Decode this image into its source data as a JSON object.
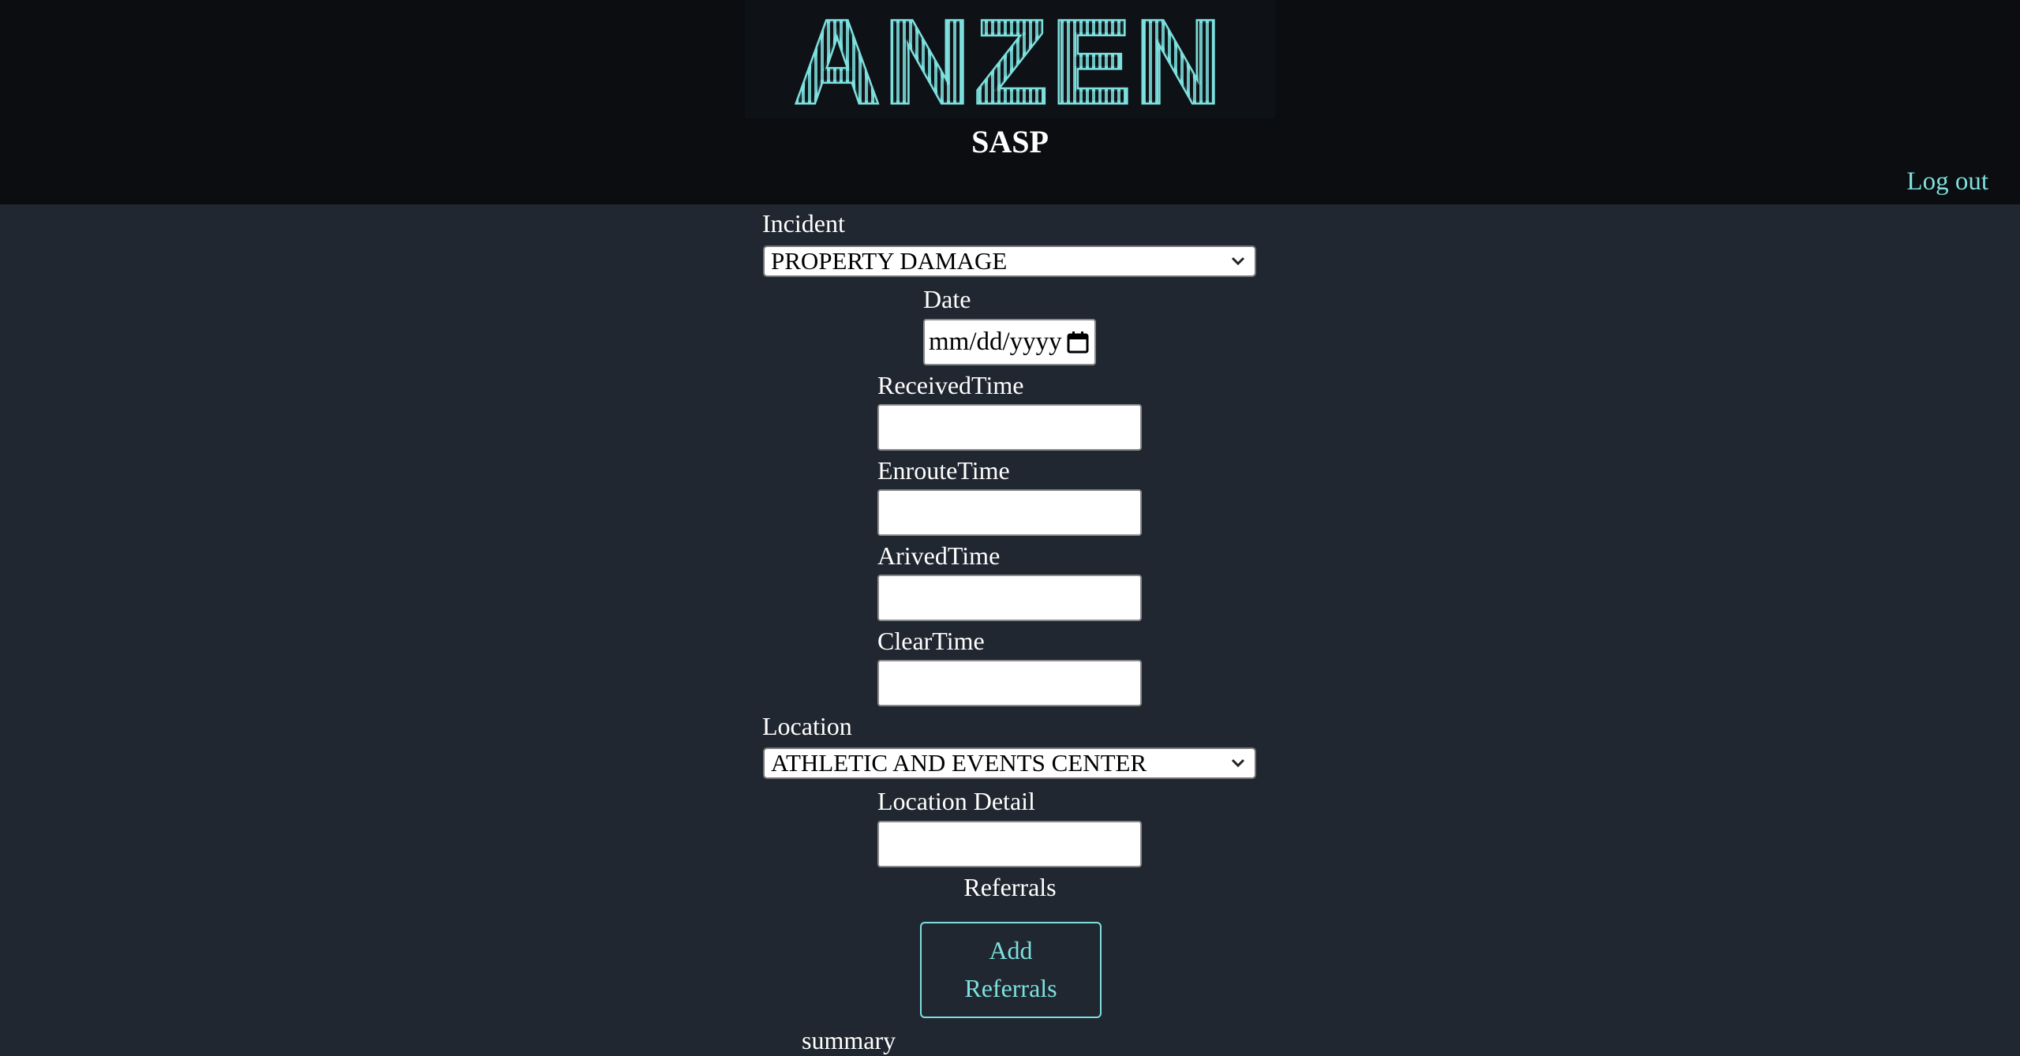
{
  "header": {
    "logo_text": "ANZEN",
    "title": "SASP",
    "logout_label": "Log out",
    "accent_color": "#7de0df"
  },
  "form": {
    "incident": {
      "label": "Incident",
      "selected": "PROPERTY DAMAGE"
    },
    "date": {
      "label": "Date",
      "placeholder": "mm/dd/yyyy"
    },
    "received_time": {
      "label": "ReceivedTime",
      "value": ""
    },
    "enroute_time": {
      "label": "EnrouteTime",
      "value": ""
    },
    "arrived_time": {
      "label": "ArivedTime",
      "value": ""
    },
    "clear_time": {
      "label": "ClearTime",
      "value": ""
    },
    "location": {
      "label": "Location",
      "selected": "ATHLETIC AND EVENTS CENTER"
    },
    "location_detail": {
      "label": "Location Detail",
      "value": ""
    },
    "referrals": {
      "label": "Referrals",
      "add_button_line1": "Add",
      "add_button_line2": "Referrals"
    },
    "summary": {
      "label": "summary"
    }
  }
}
